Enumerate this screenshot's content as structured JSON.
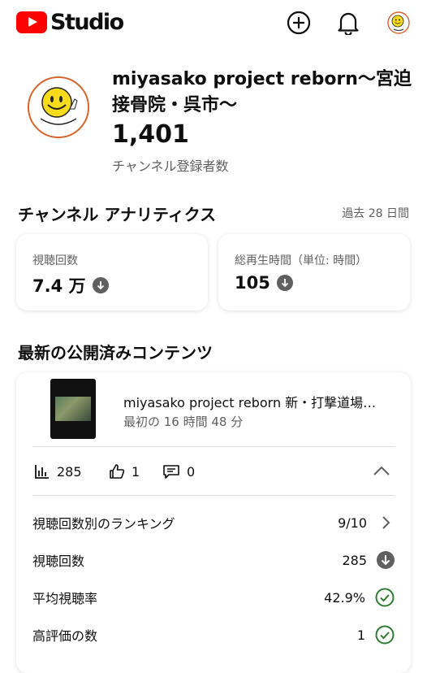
{
  "header": {
    "logo_text": "Studio"
  },
  "channel": {
    "name": "miyasako project reborn～宮迫接骨院・呉市～",
    "subscribers": "1,401",
    "subscribers_label": "チャンネル登録者数"
  },
  "analytics": {
    "title": "チャンネル アナリティクス",
    "period": "過去 28 日間",
    "cards": [
      {
        "label": "視聴回数",
        "value": "7.4 万"
      },
      {
        "label": "総再生時間（単位: 時間）",
        "value": "105"
      }
    ]
  },
  "latest": {
    "title": "最新の公開済みコンテンツ",
    "video": {
      "title": "miyasako project reborn 新・打撃道場…",
      "meta": "最初の 16 時間 48 分",
      "views": "285",
      "likes": "1",
      "comments": "0"
    },
    "metrics": [
      {
        "label": "視聴回数別のランキング",
        "value": "9/10"
      },
      {
        "label": "視聴回数",
        "value": "285"
      },
      {
        "label": "平均視聴率",
        "value": "42.9%"
      },
      {
        "label": "高評価の数",
        "value": "1"
      }
    ]
  },
  "colors": {
    "brand_red": "#ff0000",
    "check_green": "#2e7d32",
    "text_secondary": "#606060"
  }
}
